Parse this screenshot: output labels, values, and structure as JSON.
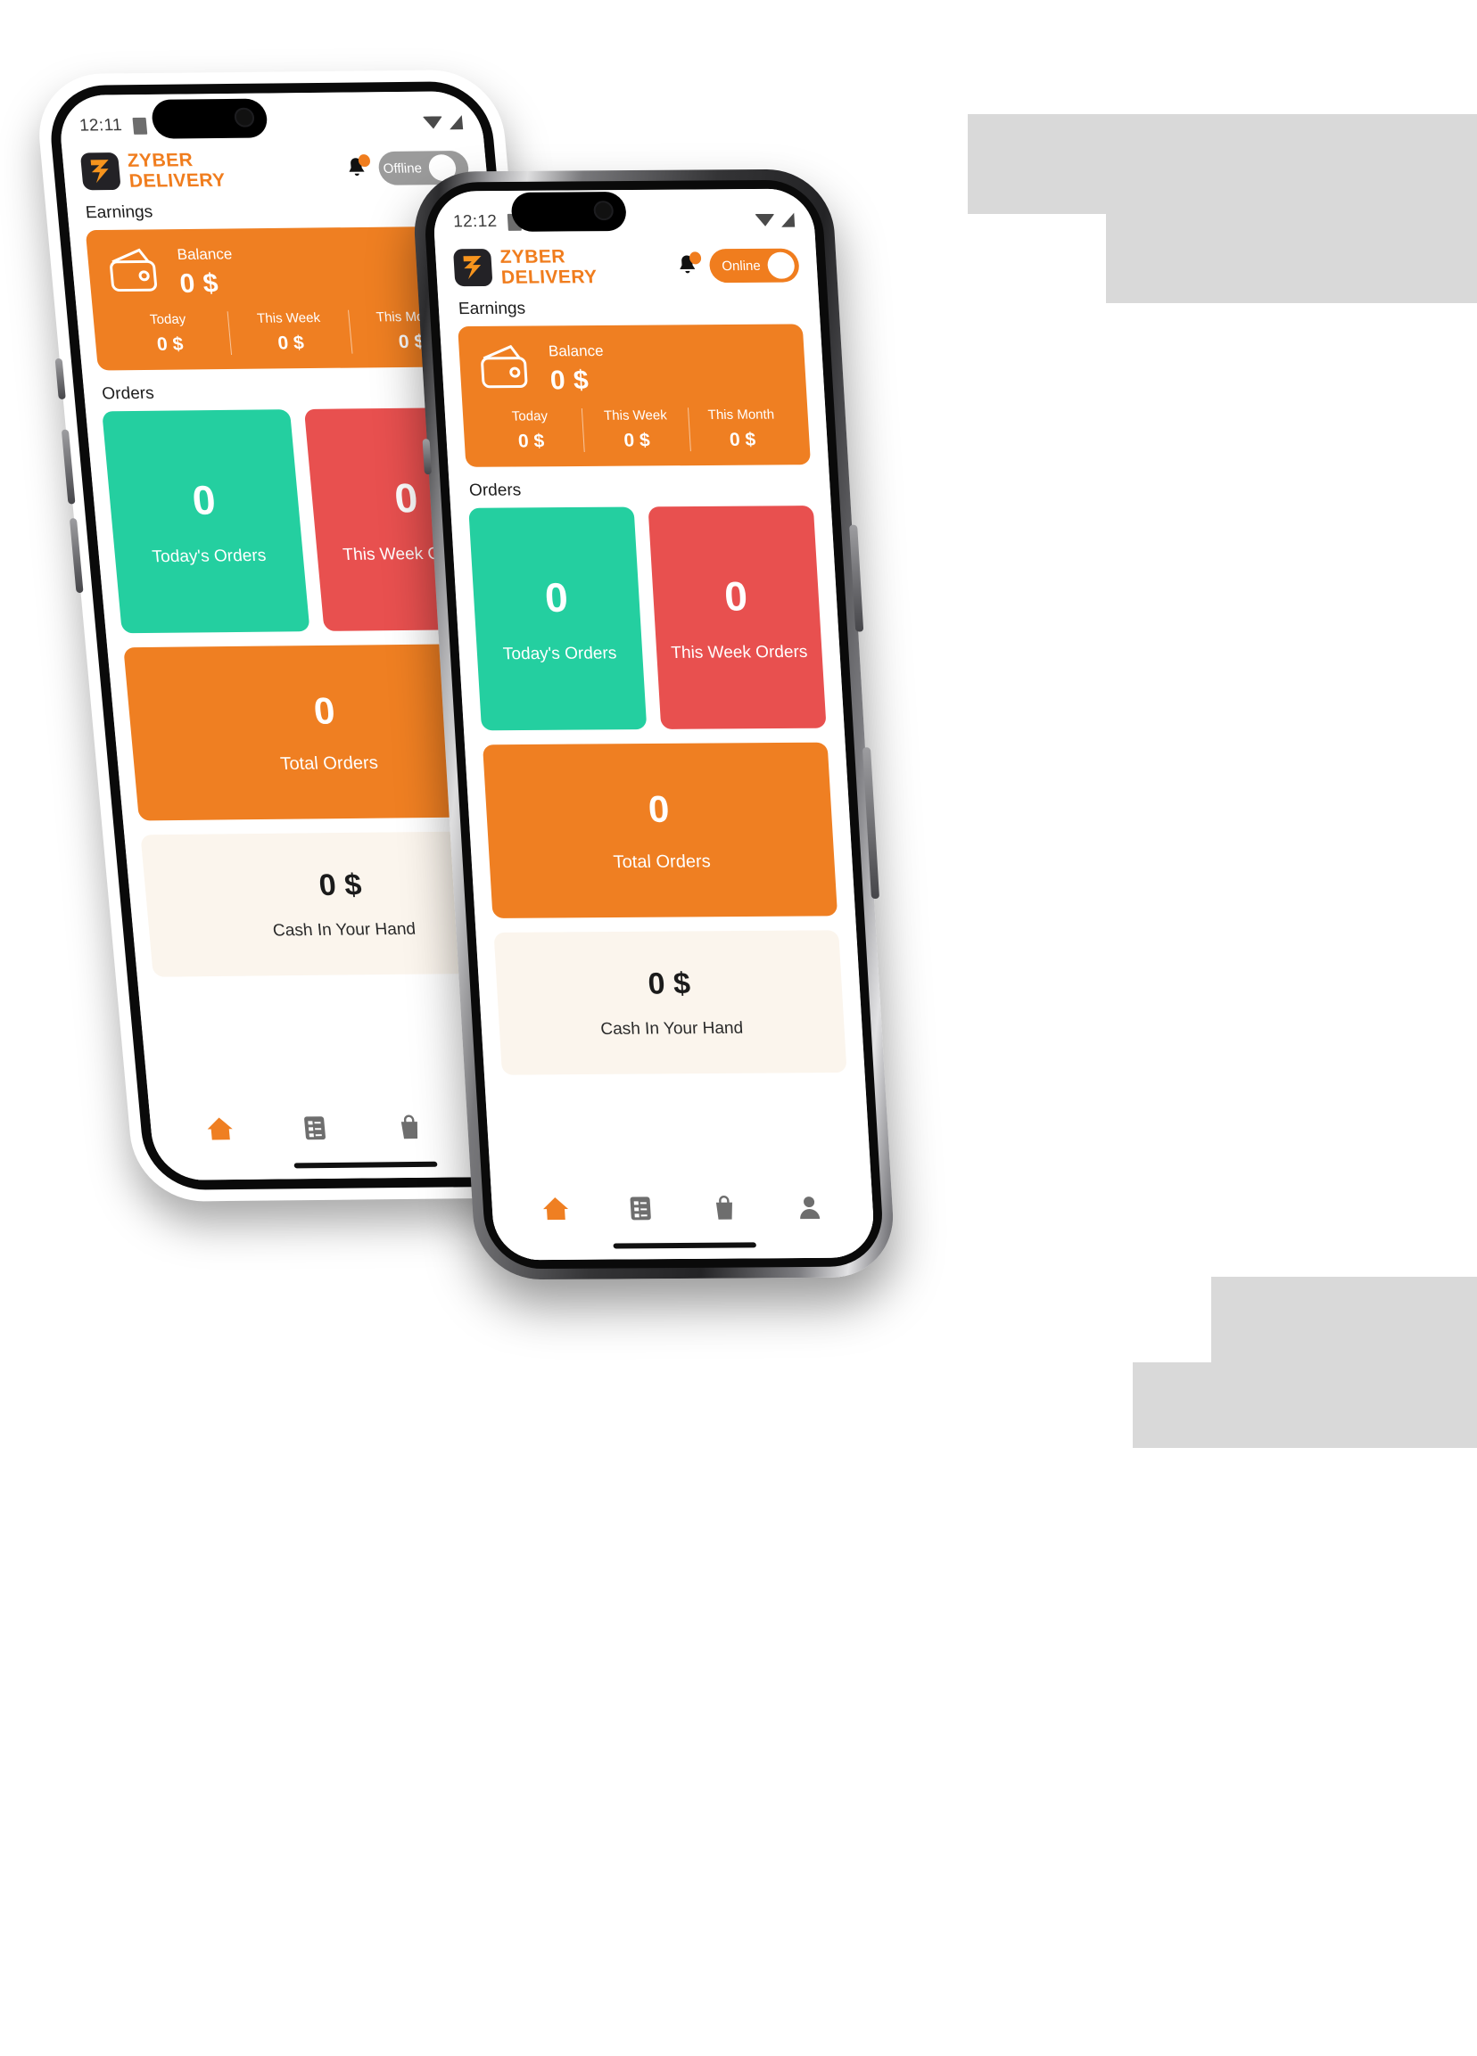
{
  "app": {
    "brand_line1": "ZYBER",
    "brand_line2": "DELIVERY",
    "accent_orange": "#ef7f22",
    "accent_teal": "#24cfa0",
    "accent_red": "#e8504f",
    "cash_card_bg": "#fbf5ed",
    "logo_icon": "zyber-z-bolt-icon"
  },
  "back_phone": {
    "status": {
      "time": "12:11",
      "battery_icon": "battery-icon",
      "mode_icon": "a-badge-icon",
      "wifi_icon": "wifi-icon",
      "signal_icon": "signal-icon"
    },
    "header": {
      "bell_icon": "bell-icon",
      "notification_dot": "notification-dot",
      "toggle_label": "Offline",
      "toggle_state": "off"
    },
    "sections": {
      "earnings_title": "Earnings",
      "orders_title": "Orders"
    },
    "earnings": {
      "wallet_icon": "wallet-icon",
      "balance_label": "Balance",
      "balance_value": "0 $",
      "stats": [
        {
          "label": "Today",
          "value": "0 $"
        },
        {
          "label": "This Week",
          "value": "0 $"
        },
        {
          "label": "This Month",
          "value": "0 $"
        }
      ]
    },
    "orders": [
      {
        "value": "0",
        "label": "Today's Orders",
        "color": "teal"
      },
      {
        "value": "0",
        "label": "This Week Orders",
        "color": "red"
      }
    ],
    "total_orders": {
      "value": "0",
      "label": "Total Orders"
    },
    "cash": {
      "value": "0 $",
      "label": "Cash In Your Hand"
    },
    "nav": [
      {
        "name": "home-icon",
        "active": true
      },
      {
        "name": "orders-list-icon",
        "active": false
      },
      {
        "name": "shopping-bag-icon",
        "active": false
      },
      {
        "name": "profile-icon",
        "active": false
      }
    ]
  },
  "front_phone": {
    "status": {
      "time": "12:12",
      "battery_icon": "battery-icon",
      "mode_icon": "a-badge-icon",
      "wifi_icon": "wifi-icon",
      "signal_icon": "signal-icon"
    },
    "header": {
      "bell_icon": "bell-icon",
      "notification_dot": "notification-dot",
      "toggle_label": "Online",
      "toggle_state": "on"
    },
    "sections": {
      "earnings_title": "Earnings",
      "orders_title": "Orders"
    },
    "earnings": {
      "wallet_icon": "wallet-icon",
      "balance_label": "Balance",
      "balance_value": "0 $",
      "stats": [
        {
          "label": "Today",
          "value": "0 $"
        },
        {
          "label": "This Week",
          "value": "0 $"
        },
        {
          "label": "This Month",
          "value": "0 $"
        }
      ]
    },
    "orders": [
      {
        "value": "0",
        "label": "Today's Orders",
        "color": "teal"
      },
      {
        "value": "0",
        "label": "This Week Orders",
        "color": "red"
      }
    ],
    "total_orders": {
      "value": "0",
      "label": "Total Orders"
    },
    "cash": {
      "value": "0 $",
      "label": "Cash In Your Hand"
    },
    "nav": [
      {
        "name": "home-icon",
        "active": true
      },
      {
        "name": "orders-list-icon",
        "active": false
      },
      {
        "name": "shopping-bag-icon",
        "active": false
      },
      {
        "name": "profile-icon",
        "active": false
      }
    ]
  }
}
